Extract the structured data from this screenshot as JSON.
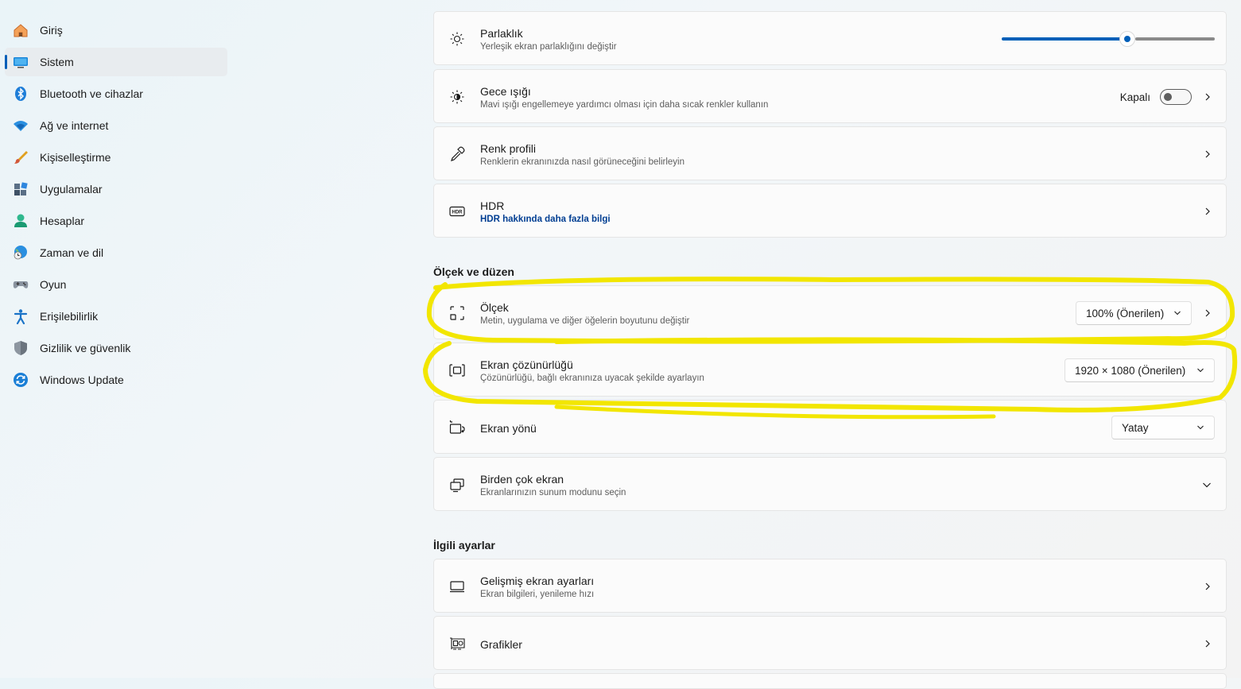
{
  "sidebar": {
    "items": [
      {
        "label": "Giriş",
        "icon": "home-icon"
      },
      {
        "label": "Sistem",
        "icon": "system-icon",
        "selected": true
      },
      {
        "label": "Bluetooth ve cihazlar",
        "icon": "bluetooth-icon"
      },
      {
        "label": "Ağ ve internet",
        "icon": "wifi-icon"
      },
      {
        "label": "Kişiselleştirme",
        "icon": "brush-icon"
      },
      {
        "label": "Uygulamalar",
        "icon": "apps-icon"
      },
      {
        "label": "Hesaplar",
        "icon": "account-icon"
      },
      {
        "label": "Zaman ve dil",
        "icon": "globe-clock-icon"
      },
      {
        "label": "Oyun",
        "icon": "gamepad-icon"
      },
      {
        "label": "Erişilebilirlik",
        "icon": "accessibility-icon"
      },
      {
        "label": "Gizlilik ve güvenlik",
        "icon": "shield-icon"
      },
      {
        "label": "Windows Update",
        "icon": "update-icon"
      }
    ]
  },
  "main": {
    "cards": {
      "brightness": {
        "title": "Parlaklık",
        "subtitle": "Yerleşik ekran parlaklığını değiştir",
        "value_percent": 59,
        "icon": "sun-icon"
      },
      "night_light": {
        "title": "Gece ışığı",
        "subtitle": "Mavi ışığı engellemeye yardımcı olması için daha sıcak renkler kullanın",
        "toggle_label": "Kapalı",
        "toggle_on": false,
        "icon": "night-light-icon"
      },
      "color_profile": {
        "title": "Renk profili",
        "subtitle": "Renklerin ekranınızda nasıl görüneceğini belirleyin",
        "icon": "eyedropper-icon"
      },
      "hdr": {
        "title": "HDR",
        "link": "HDR hakkında daha fazla bilgi",
        "icon": "hdr-icon"
      }
    },
    "scale_section": {
      "header": "Ölçek ve düzen",
      "scale": {
        "title": "Ölçek",
        "subtitle": "Metin, uygulama ve diğer öğelerin boyutunu değiştir",
        "value": "100% (Önerilen)",
        "icon": "scale-icon"
      },
      "resolution": {
        "title": "Ekran çözünürlüğü",
        "subtitle": "Çözünürlüğü, bağlı ekranınıza uyacak şekilde ayarlayın",
        "value": "1920 × 1080 (Önerilen)",
        "icon": "resolution-icon"
      },
      "orientation": {
        "title": "Ekran yönü",
        "value": "Yatay",
        "icon": "orientation-icon"
      },
      "multi_display": {
        "title": "Birden çok ekran",
        "subtitle": "Ekranlarınızın sunum modunu seçin",
        "icon": "multi-display-icon"
      }
    },
    "related_section": {
      "header": "İlgili ayarlar",
      "advanced": {
        "title": "Gelişmiş ekran ayarları",
        "subtitle": "Ekran bilgileri, yenileme hızı",
        "icon": "monitor-icon"
      },
      "graphics": {
        "title": "Grafikler",
        "icon": "graphics-card-icon"
      }
    }
  },
  "colors": {
    "accent": "#005fb8",
    "highlight": "#f2e600"
  }
}
